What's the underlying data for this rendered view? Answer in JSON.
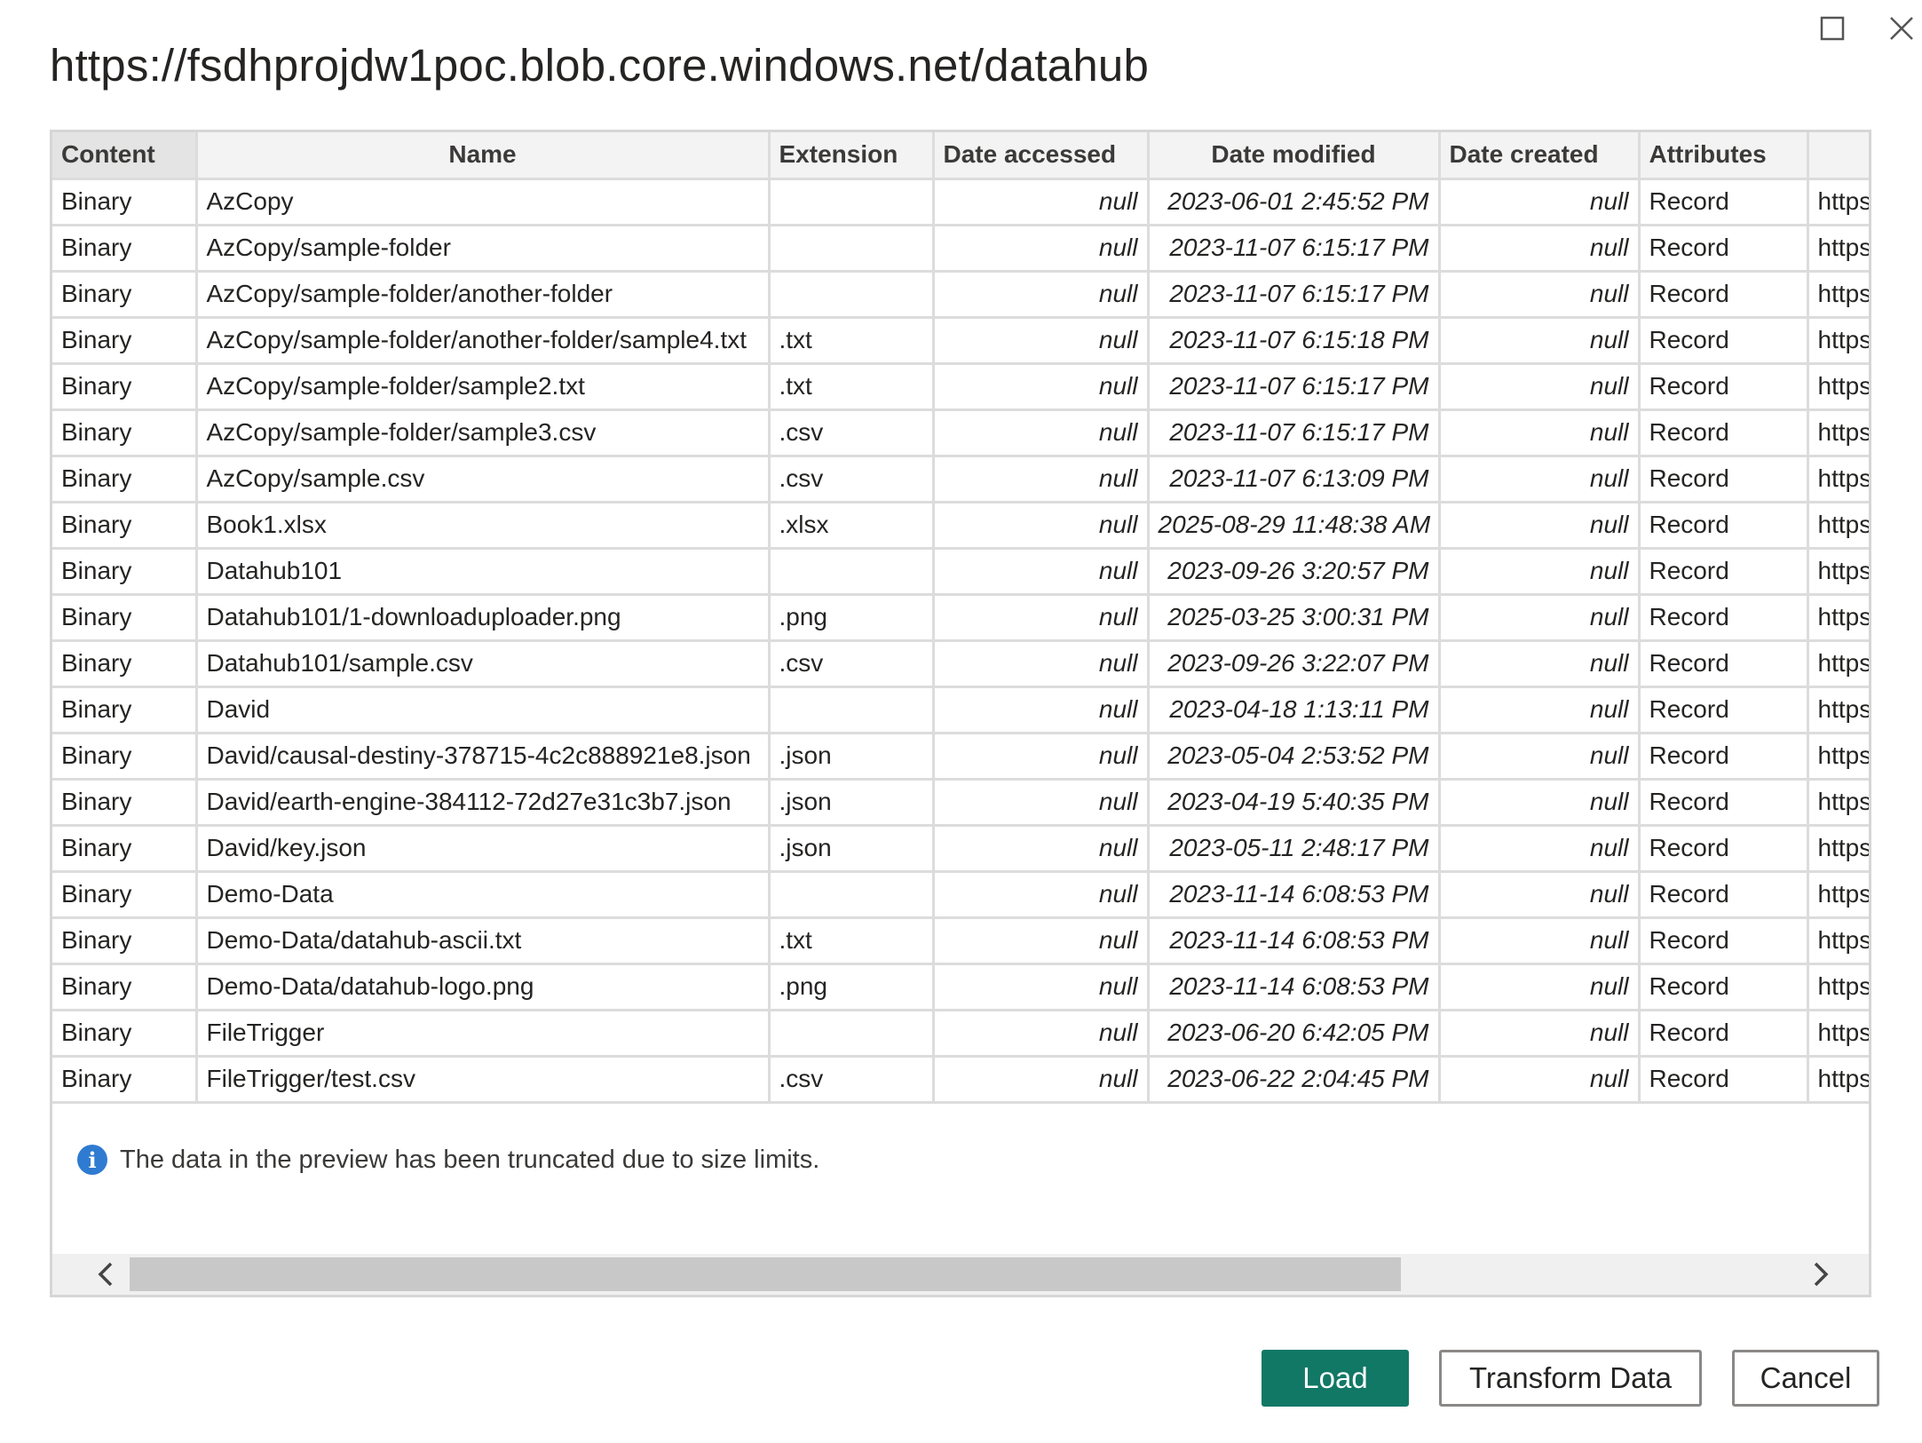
{
  "dialog": {
    "title": "https://fsdhprojdw1poc.blob.core.windows.net/datahub"
  },
  "table": {
    "columns": [
      "Content",
      "Name",
      "Extension",
      "Date accessed",
      "Date modified",
      "Date created",
      "Attributes",
      ""
    ],
    "rows": [
      [
        "Binary",
        "AzCopy",
        "",
        "null",
        "2023-06-01 2:45:52 PM",
        "null",
        "Record",
        "https:"
      ],
      [
        "Binary",
        "AzCopy/sample-folder",
        "",
        "null",
        "2023-11-07 6:15:17 PM",
        "null",
        "Record",
        "https:"
      ],
      [
        "Binary",
        "AzCopy/sample-folder/another-folder",
        "",
        "null",
        "2023-11-07 6:15:17 PM",
        "null",
        "Record",
        "https:"
      ],
      [
        "Binary",
        "AzCopy/sample-folder/another-folder/sample4.txt",
        ".txt",
        "null",
        "2023-11-07 6:15:18 PM",
        "null",
        "Record",
        "https:"
      ],
      [
        "Binary",
        "AzCopy/sample-folder/sample2.txt",
        ".txt",
        "null",
        "2023-11-07 6:15:17 PM",
        "null",
        "Record",
        "https:"
      ],
      [
        "Binary",
        "AzCopy/sample-folder/sample3.csv",
        ".csv",
        "null",
        "2023-11-07 6:15:17 PM",
        "null",
        "Record",
        "https:"
      ],
      [
        "Binary",
        "AzCopy/sample.csv",
        ".csv",
        "null",
        "2023-11-07 6:13:09 PM",
        "null",
        "Record",
        "https:"
      ],
      [
        "Binary",
        "Book1.xlsx",
        ".xlsx",
        "null",
        "2025-08-29 11:48:38 AM",
        "null",
        "Record",
        "https:"
      ],
      [
        "Binary",
        "Datahub101",
        "",
        "null",
        "2023-09-26 3:20:57 PM",
        "null",
        "Record",
        "https:"
      ],
      [
        "Binary",
        "Datahub101/1-downloaduploader.png",
        ".png",
        "null",
        "2025-03-25 3:00:31 PM",
        "null",
        "Record",
        "https:"
      ],
      [
        "Binary",
        "Datahub101/sample.csv",
        ".csv",
        "null",
        "2023-09-26 3:22:07 PM",
        "null",
        "Record",
        "https:"
      ],
      [
        "Binary",
        "David",
        "",
        "null",
        "2023-04-18 1:13:11 PM",
        "null",
        "Record",
        "https:"
      ],
      [
        "Binary",
        "David/causal-destiny-378715-4c2c888921e8.json",
        ".json",
        "null",
        "2023-05-04 2:53:52 PM",
        "null",
        "Record",
        "https:"
      ],
      [
        "Binary",
        "David/earth-engine-384112-72d27e31c3b7.json",
        ".json",
        "null",
        "2023-04-19 5:40:35 PM",
        "null",
        "Record",
        "https:"
      ],
      [
        "Binary",
        "David/key.json",
        ".json",
        "null",
        "2023-05-11 2:48:17 PM",
        "null",
        "Record",
        "https:"
      ],
      [
        "Binary",
        "Demo-Data",
        "",
        "null",
        "2023-11-14 6:08:53 PM",
        "null",
        "Record",
        "https:"
      ],
      [
        "Binary",
        "Demo-Data/datahub-ascii.txt",
        ".txt",
        "null",
        "2023-11-14 6:08:53 PM",
        "null",
        "Record",
        "https:"
      ],
      [
        "Binary",
        "Demo-Data/datahub-logo.png",
        ".png",
        "null",
        "2023-11-14 6:08:53 PM",
        "null",
        "Record",
        "https:"
      ],
      [
        "Binary",
        "FileTrigger",
        "",
        "null",
        "2023-06-20 6:42:05 PM",
        "null",
        "Record",
        "https:"
      ],
      [
        "Binary",
        "FileTrigger/test.csv",
        ".csv",
        "null",
        "2023-06-22 2:04:45 PM",
        "null",
        "Record",
        "https:"
      ]
    ]
  },
  "notice": {
    "icon": "info-icon",
    "text": "The data in the preview has been truncated due to size limits."
  },
  "buttons": {
    "load": "Load",
    "transform": "Transform Data",
    "cancel": "Cancel"
  },
  "colors": {
    "primary": "#117865",
    "info": "#2f7bd1"
  },
  "icons": {
    "maximize": "maximize-icon",
    "close": "close-icon",
    "scroll_left": "chevron-left-icon",
    "scroll_right": "chevron-right-icon"
  }
}
